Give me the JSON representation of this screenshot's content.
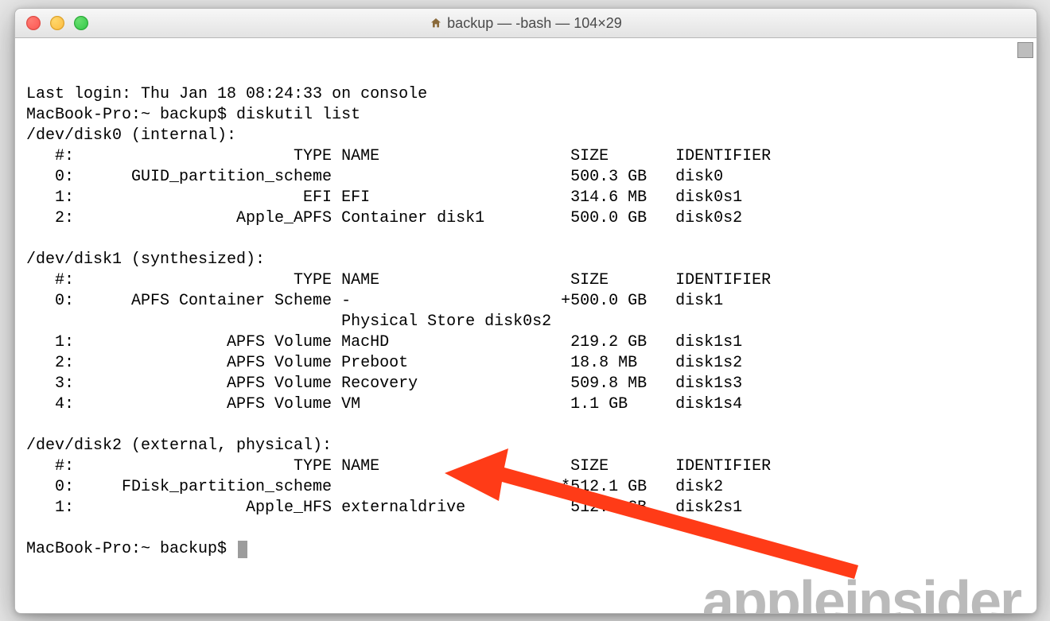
{
  "title": "backup — -bash — 104×29",
  "watermark": "appleinsider",
  "terminal": {
    "last_login": "Last login: Thu Jan 18 08:24:33 on console",
    "prompt1": "MacBook-Pro:~ backup$ diskutil list",
    "disk0_header": "/dev/disk0 (internal):",
    "hdr_cols": "   #:                       TYPE NAME                    SIZE       IDENTIFIER",
    "d0_0": "   0:      GUID_partition_scheme                         500.3 GB   disk0",
    "d0_1": "   1:                        EFI EFI                     314.6 MB   disk0s1",
    "d0_2": "   2:                 Apple_APFS Container disk1         500.0 GB   disk0s2",
    "disk1_header": "/dev/disk1 (synthesized):",
    "d1_0": "   0:      APFS Container Scheme -                      +500.0 GB   disk1",
    "d1_phys": "                                 Physical Store disk0s2",
    "d1_1": "   1:                APFS Volume MacHD                   219.2 GB   disk1s1",
    "d1_2": "   2:                APFS Volume Preboot                 18.8 MB    disk1s2",
    "d1_3": "   3:                APFS Volume Recovery                509.8 MB   disk1s3",
    "d1_4": "   4:                APFS Volume VM                      1.1 GB     disk1s4",
    "disk2_header": "/dev/disk2 (external, physical):",
    "d2_0": "   0:     FDisk_partition_scheme                        *512.1 GB   disk2",
    "d2_1": "   1:                  Apple_HFS externaldrive           512.1 GB   disk2s1",
    "prompt2": "MacBook-Pro:~ backup$ "
  }
}
